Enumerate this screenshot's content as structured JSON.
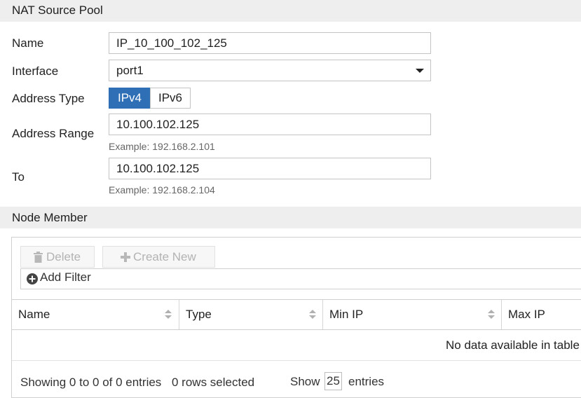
{
  "section1": {
    "title": "NAT Source Pool"
  },
  "form": {
    "name_label": "Name",
    "name_value": "IP_10_100_102_125",
    "interface_label": "Interface",
    "interface_value": "port1",
    "address_type_label": "Address Type",
    "address_type_options": [
      "IPv4",
      "IPv6"
    ],
    "address_type_selected": "IPv4",
    "address_range_label": "Address Range",
    "address_range_value": "10.100.102.125",
    "address_range_hint": "Example: 192.168.2.101",
    "to_label": "To",
    "to_value": "10.100.102.125",
    "to_hint": "Example: 192.168.2.104"
  },
  "section2": {
    "title": "Node Member"
  },
  "toolbar": {
    "delete_label": "Delete",
    "create_label": "Create New",
    "filter_label": "Add Filter"
  },
  "table": {
    "columns": [
      "Name",
      "Type",
      "Min IP",
      "Max IP"
    ],
    "empty_message": "No data available in table"
  },
  "footer": {
    "showing": "Showing 0 to 0 of 0 entries",
    "selected": "0 rows selected",
    "show_label": "Show",
    "page_size": "25",
    "entries_label": "entries"
  },
  "colors": {
    "accent": "#2f6fb5",
    "section_bg": "#eeeeee"
  }
}
